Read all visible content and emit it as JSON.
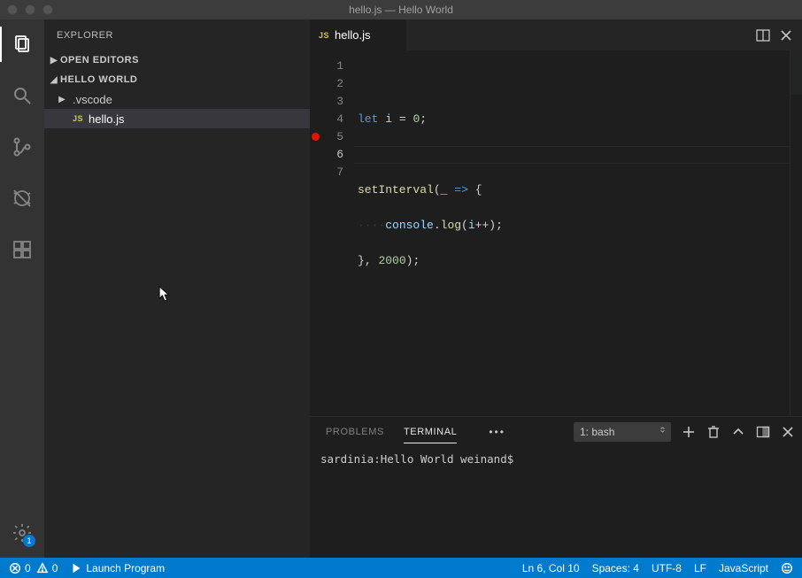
{
  "window": {
    "title": "hello.js — Hello World"
  },
  "activitybar": {
    "settings_badge": "1"
  },
  "sidebar": {
    "header": "EXPLORER",
    "sections": {
      "open_editors": "OPEN EDITORS",
      "workspace": "HELLO WORLD"
    },
    "tree": {
      "vscode_folder": ".vscode",
      "hello_file": "hello.js"
    }
  },
  "tabs": {
    "hello": "hello.js"
  },
  "editor": {
    "lines": [
      "1",
      "2",
      "3",
      "4",
      "5",
      "6",
      "7"
    ],
    "breakpoint_line": 5,
    "cursor_line": 6,
    "code": {
      "l2": {
        "let": "let",
        "i": "i",
        "eq": "=",
        "zero": "0",
        "semi": ";"
      },
      "l4": {
        "fn": "setInterval",
        "open": "(",
        "us": "_",
        "arrow": "=>",
        "brace": "{"
      },
      "l5": {
        "dots": "····",
        "console": "console",
        "dot": ".",
        "log": "log",
        "open": "(",
        "i": "i",
        "pp": "++",
        "close": ")",
        "semi": ";"
      },
      "l6": {
        "brace": "}",
        "comma": ",",
        "num": "2000",
        "close": ")",
        "semi": ";"
      }
    }
  },
  "panel": {
    "tabs": {
      "problems": "PROBLEMS",
      "terminal": "TERMINAL"
    },
    "terminal_select": "1: bash",
    "prompt": "sardinia:Hello World weinand$"
  },
  "statusbar": {
    "errors": "0",
    "warnings": "0",
    "launch": "Launch Program",
    "ln_col": "Ln 6, Col 10",
    "spaces": "Spaces: 4",
    "encoding": "UTF-8",
    "eol": "LF",
    "language": "JavaScript"
  }
}
